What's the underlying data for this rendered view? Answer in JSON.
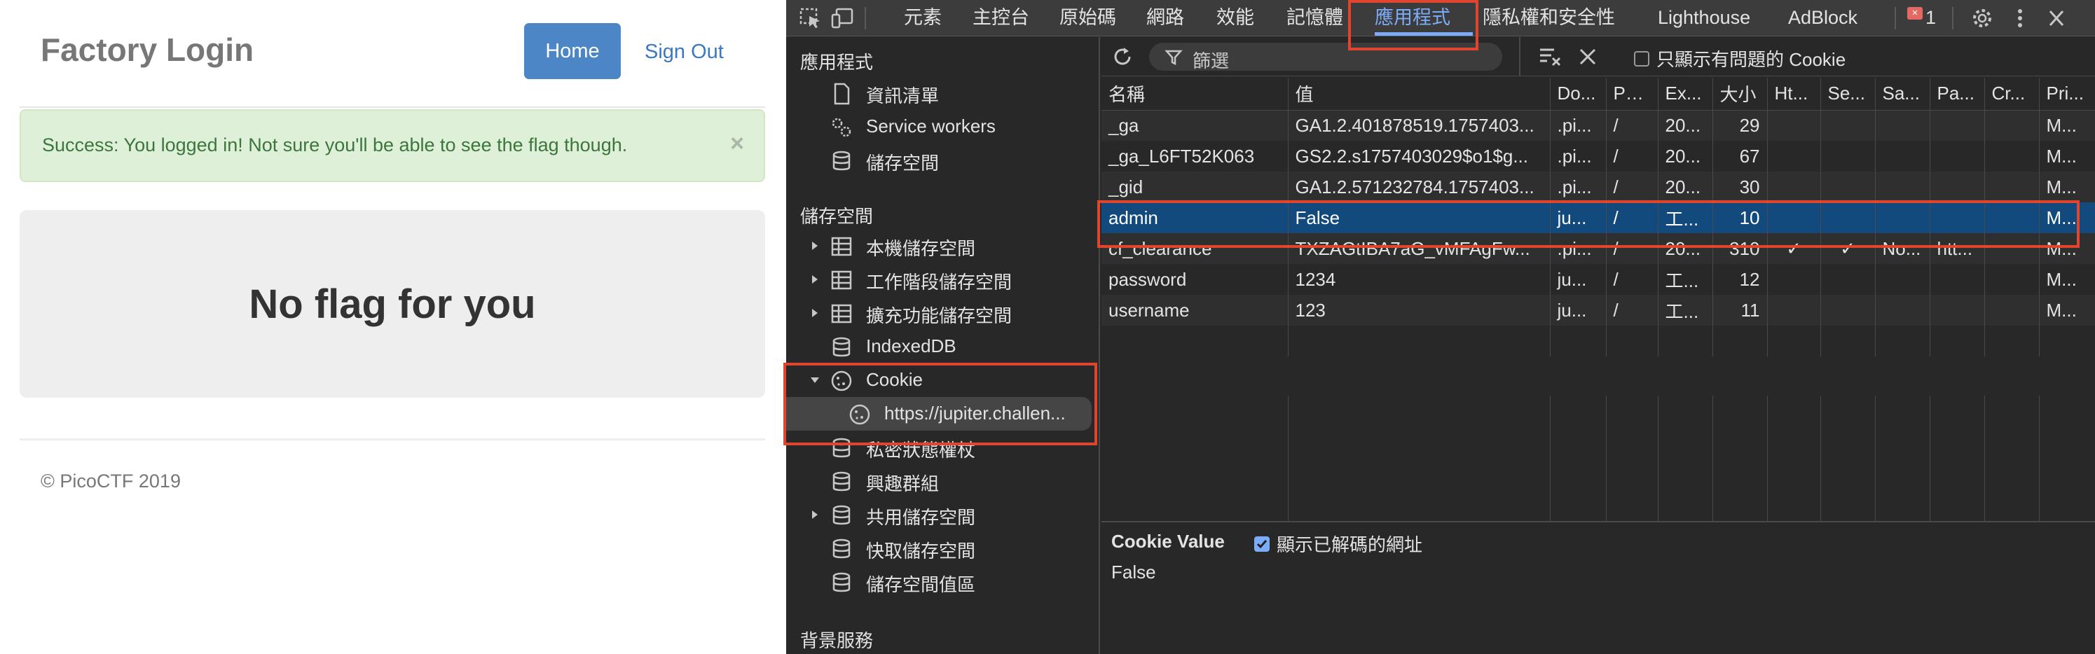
{
  "webpage": {
    "brand": "Factory Login",
    "nav": {
      "home": "Home",
      "sign_out": "Sign Out"
    },
    "alert": {
      "message": "Success: You logged in! Not sure you'll be able to see the flag though.",
      "close": "×"
    },
    "jumbotron": "No flag for you",
    "footer": "© PicoCTF 2019"
  },
  "devtools": {
    "tabs": [
      "元素",
      "主控台",
      "原始碼",
      "網路",
      "效能",
      "記憶體",
      "應用程式",
      "隱私權和安全性",
      "Lighthouse",
      "AdBlock"
    ],
    "active_tab": "應用程式",
    "error_count": "1",
    "sidebar": {
      "app_header": "應用程式",
      "app_items": [
        "資訊清單",
        "Service workers",
        "儲存空間"
      ],
      "storage_header": "儲存空間",
      "storage_items": [
        "本機儲存空間",
        "工作階段儲存空間",
        "擴充功能儲存空間",
        "IndexedDB",
        "Cookie"
      ],
      "cookie_origin": "https://jupiter.challen...",
      "other_items": [
        "私密狀態權杖",
        "興趣群組",
        "共用儲存空間",
        "快取儲存空間",
        "儲存空間值區"
      ],
      "background_header": "背景服務"
    },
    "toolbar": {
      "filter_placeholder": "篩選",
      "only_issues_label": "只顯示有問題的 Cookie"
    },
    "cookie_table": {
      "columns": [
        "名稱",
        "值",
        "Do...",
        "Path",
        "Ex...",
        "大小",
        "Ht...",
        "Se...",
        "Sa...",
        "Pa...",
        "Cr...",
        "Pri..."
      ],
      "rows": [
        [
          "_ga",
          "GA1.2.401878519.1757403...",
          ".pi...",
          "/",
          "20...",
          "29",
          "",
          "",
          "",
          "",
          "",
          "M..."
        ],
        [
          "_ga_L6FT52K063",
          "GS2.2.s1757403029$o1$g...",
          ".pi...",
          "/",
          "20...",
          "67",
          "",
          "",
          "",
          "",
          "",
          "M..."
        ],
        [
          "_gid",
          "GA1.2.571232784.1757403...",
          ".pi...",
          "/",
          "20...",
          "30",
          "",
          "",
          "",
          "",
          "",
          "M..."
        ],
        [
          "admin",
          "False",
          "ju...",
          "/",
          "工...",
          "10",
          "",
          "",
          "",
          "",
          "",
          "M..."
        ],
        [
          "cf_clearance",
          "TXZAGtIBA7aG_vMFAgFw...",
          ".pi...",
          "/",
          "20...",
          "310",
          "✓",
          "✓",
          "No...",
          "htt...",
          "",
          "M..."
        ],
        [
          "password",
          "1234",
          "ju...",
          "/",
          "工...",
          "12",
          "",
          "",
          "",
          "",
          "",
          "M..."
        ],
        [
          "username",
          "123",
          "ju...",
          "/",
          "工...",
          "11",
          "",
          "",
          "",
          "",
          "",
          "M..."
        ]
      ],
      "selected_row": 3
    },
    "value_pane": {
      "title": "Cookie Value",
      "decode_label": "顯示已解碼的網址",
      "value": "False"
    }
  },
  "colors": {
    "highlight": "#e0452f",
    "accent": "#7cacf8",
    "selection": "#124a7d",
    "home_button": "#4d86c6",
    "success_bg": "#dff0d8"
  }
}
